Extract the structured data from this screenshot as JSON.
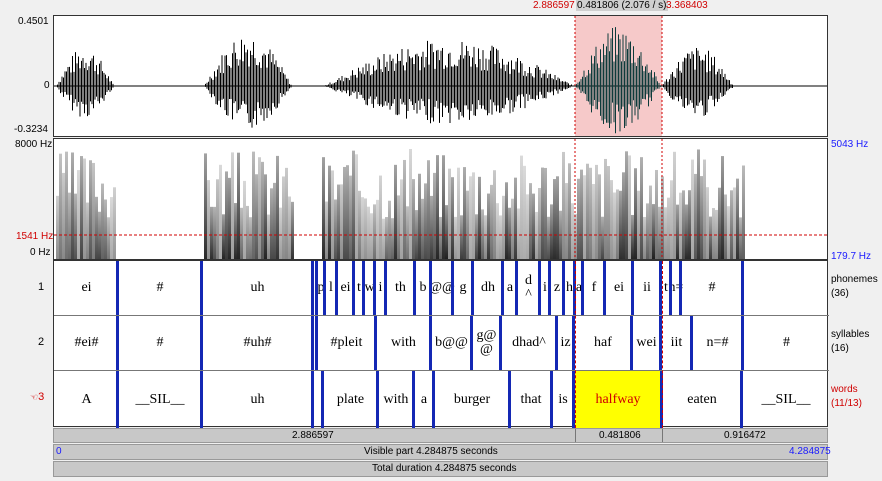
{
  "selection": {
    "start": "2.886597",
    "mid": "0.481806 (2.076 / s)",
    "end": "3.368403"
  },
  "waveform": {
    "top": "0.4501",
    "zero": "0",
    "bottom": "-0.3234"
  },
  "spectrogram": {
    "left_top": "8000 Hz",
    "cursor_freq": "1541 Hz",
    "left_bottom": "0 Hz",
    "right_top": "5043 Hz",
    "right_bottom": "179.7 Hz"
  },
  "tiers": [
    {
      "number": "1",
      "name": "phonemes",
      "count": "(36)",
      "intervals": [
        "ei",
        "#",
        "uh",
        "",
        "p",
        "l",
        "ei",
        "t",
        "w",
        "i",
        "th",
        "b",
        "@@",
        "g",
        "dh",
        "a",
        "d ^",
        "i",
        "z",
        "h",
        "a",
        "f",
        "ei",
        "ii",
        "t",
        "n=",
        "#"
      ]
    },
    {
      "number": "2",
      "name": "syllables",
      "count": "(16)",
      "intervals": [
        "#ei#",
        "#",
        "#uh#",
        "#pleit",
        "with",
        "b@@",
        "g@ @",
        "dhad^",
        "iz",
        "haf",
        "wei",
        "iit",
        "n=#",
        "#"
      ]
    },
    {
      "number": "3",
      "name": "words",
      "count": "(11/13)",
      "intervals": [
        "A",
        "__SIL__",
        "uh",
        "plate",
        "with",
        "a",
        "burger",
        "that",
        "is",
        "halfway",
        "eaten",
        "__SIL__"
      ]
    }
  ],
  "durations": {
    "before": "2.886597",
    "selected": "0.481806",
    "after": "0.916472"
  },
  "visible": {
    "start": "0",
    "label": "Visible part 4.284875 seconds",
    "end": "4.284875"
  },
  "total": "Total duration 4.284875 seconds",
  "colors": {
    "selection": "#f6c9c9",
    "boundary": "#1428b4",
    "highlight": "#ffff00",
    "cursor": "#d00000"
  }
}
